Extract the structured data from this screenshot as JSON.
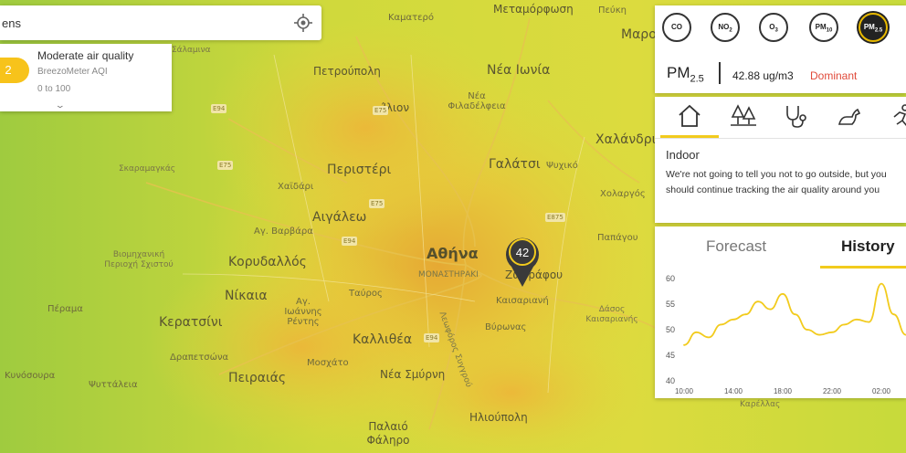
{
  "search": {
    "value": "ens",
    "locate_icon": "crosshair-icon"
  },
  "aqi_card": {
    "index_value": "2",
    "title": "Moderate air quality",
    "scale_name": "BreezoMeter AQI",
    "scale_range": "0 to 100",
    "expand_icon": "chevron-down-icon",
    "pill_color": "#f7c31b"
  },
  "pollutants": {
    "buttons": [
      {
        "label": "CO",
        "sub": ""
      },
      {
        "label": "NO",
        "sub": "2"
      },
      {
        "label": "O",
        "sub": "3"
      },
      {
        "label": "PM",
        "sub": "10"
      },
      {
        "label": "PM",
        "sub": "2.5"
      }
    ],
    "selected": {
      "name": "PM",
      "sub": "2.5",
      "value": "42.88 ug/m3",
      "status": "Dominant"
    },
    "dominant_color": "#e04a3a"
  },
  "recommendations": {
    "tabs": [
      {
        "name": "home-icon"
      },
      {
        "name": "trees-icon"
      },
      {
        "name": "stethoscope-icon"
      },
      {
        "name": "dog-icon"
      },
      {
        "name": "running-icon"
      }
    ],
    "title": "Indoor",
    "text": "We're not going to tell you not to go outside, but you should continue tracking the air quality around you"
  },
  "chart_panel": {
    "tab_forecast": "Forecast",
    "tab_history": "History",
    "active_tab": "History"
  },
  "chart_data": {
    "type": "line",
    "x": [
      "10:00",
      "11:00",
      "12:00",
      "13:00",
      "14:00",
      "15:00",
      "16:00",
      "17:00",
      "18:00",
      "19:00",
      "20:00",
      "21:00",
      "22:00",
      "23:00",
      "00:00",
      "01:00",
      "02:00",
      "03:00",
      "04:00"
    ],
    "x_tick_labels": [
      "10:00",
      "14:00",
      "18:00",
      "22:00",
      "02:00"
    ],
    "series": [
      {
        "values": [
          47,
          49.5,
          48.5,
          51,
          52,
          53,
          55.5,
          54,
          57,
          53,
          50,
          49,
          49.5,
          51,
          52,
          51.5,
          59,
          53,
          49
        ]
      }
    ],
    "ylim": [
      40,
      60
    ],
    "y_ticks": [
      40,
      45,
      50,
      55,
      60
    ],
    "line_color": "#f2cb1d",
    "grid": false
  },
  "marker": {
    "value": "42",
    "color": "#3a3a3a",
    "ring_color": "#f2cb1d"
  },
  "map": {
    "places": [
      {
        "text": "Καματερό",
        "cls": "pl"
      },
      {
        "text": "Μεταμόρφωση",
        "cls": "pl med"
      },
      {
        "text": "Πεύκη",
        "cls": "pl"
      },
      {
        "text": "Μαρο",
        "cls": "pl big"
      },
      {
        "text": "Πετρούπολη",
        "cls": "pl med"
      },
      {
        "text": "Νέα Ιωνία",
        "cls": "pl big"
      },
      {
        "text": "Ίλιον",
        "cls": "pl med"
      },
      {
        "text": "Νέα Φιλαδέλφεια",
        "cls": "pl"
      },
      {
        "text": "Χαλάνδρι",
        "cls": "pl big"
      },
      {
        "text": "Σκαραμαγκάς",
        "cls": "pl small"
      },
      {
        "text": "Περιστέρι",
        "cls": "pl big"
      },
      {
        "text": "Γαλάτσι",
        "cls": "pl big"
      },
      {
        "text": "Ψυχικό",
        "cls": "pl"
      },
      {
        "text": "Χαϊδάρι",
        "cls": "pl"
      },
      {
        "text": "Χολαργός",
        "cls": "pl"
      },
      {
        "text": "Αιγάλεω",
        "cls": "pl big"
      },
      {
        "text": "Αγ. Βαρβάρα",
        "cls": "pl"
      },
      {
        "text": "Παπάγου",
        "cls": "pl"
      },
      {
        "text": "Αθήνα",
        "cls": "pl city"
      },
      {
        "text": "Βιομηχανική Περιοχή Σχιστού",
        "cls": "pl small"
      },
      {
        "text": "Κορυδαλλός",
        "cls": "pl big"
      },
      {
        "text": "ΜΟΝΑΣΤΗΡΑΚΙ",
        "cls": "pl small"
      },
      {
        "text": "Ζωγράφου",
        "cls": "pl med"
      },
      {
        "text": "Νίκαια",
        "cls": "pl big"
      },
      {
        "text": "Αγ. Ιωάννης Ρέντης",
        "cls": "pl"
      },
      {
        "text": "Ταύρος",
        "cls": "pl"
      },
      {
        "text": "Καισαριανή",
        "cls": "pl"
      },
      {
        "text": "Πέραμα",
        "cls": "pl"
      },
      {
        "text": "Δάσος Καισαριανής",
        "cls": "pl small"
      },
      {
        "text": "Κερατσίνι",
        "cls": "pl big"
      },
      {
        "text": "Καλλιθέα",
        "cls": "pl big"
      },
      {
        "text": "Βύρωνας",
        "cls": "pl"
      },
      {
        "text": "Δραπετσώνα",
        "cls": "pl"
      },
      {
        "text": "Μοσχάτο",
        "cls": "pl"
      },
      {
        "text": "Κυνόσουρα",
        "cls": "pl"
      },
      {
        "text": "Πειραιάς",
        "cls": "pl big"
      },
      {
        "text": "Νέα Σμύρνη",
        "cls": "pl med"
      },
      {
        "text": "Ψυττάλεια",
        "cls": "pl"
      },
      {
        "text": "Καρέλλας",
        "cls": "pl small"
      },
      {
        "text": "Ηλιούπολη",
        "cls": "pl med"
      },
      {
        "text": "Παλαιό Φάληρο",
        "cls": "pl med"
      },
      {
        "text": "Σάλαμινα",
        "cls": "pl small"
      },
      {
        "text": "Λεωφόρος Συγγρού",
        "cls": "pl small"
      }
    ],
    "shields": [
      "E94",
      "E75",
      "E75",
      "E94",
      "E875",
      "E94",
      "E75"
    ]
  }
}
